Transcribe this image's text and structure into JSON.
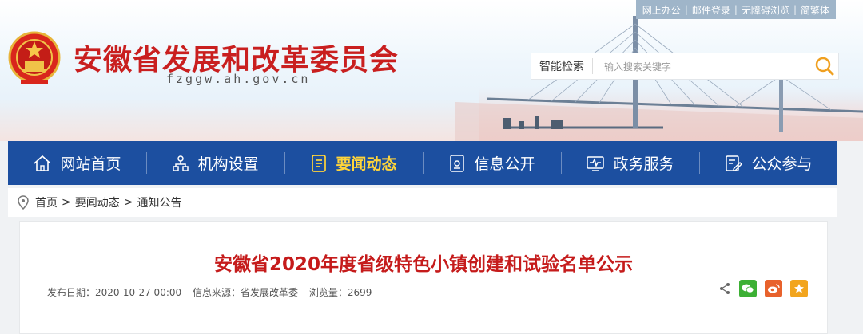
{
  "top_links": [
    "网上办公",
    "邮件登录",
    "无障碍浏览",
    "简繁体"
  ],
  "site": {
    "title": "安徽省发展和改革委员会",
    "domain": "fzggw.ah.gov.cn"
  },
  "search": {
    "label": "智能检索",
    "placeholder": "输入搜索关键字"
  },
  "nav": {
    "items": [
      {
        "label": "网站首页",
        "icon": "home-icon"
      },
      {
        "label": "机构设置",
        "icon": "org-chart-icon"
      },
      {
        "label": "要闻动态",
        "icon": "document-icon",
        "active": true
      },
      {
        "label": "信息公开",
        "icon": "info-board-icon"
      },
      {
        "label": "政务服务",
        "icon": "monitor-pulse-icon"
      },
      {
        "label": "公众参与",
        "icon": "edit-form-icon"
      }
    ],
    "active_color": "#ffd43a",
    "bg_color": "#1c4fa0"
  },
  "breadcrumb": [
    "首页",
    "要闻动态",
    "通知公告"
  ],
  "article": {
    "title": "安徽省2020年度省级特色小镇创建和试验名单公示",
    "publish_date": "发布日期：2020-10-27 00:00",
    "source": "信息来源：省发展改革委",
    "views": "浏览量：2699"
  },
  "share_icons": [
    "share-icon",
    "wechat-icon",
    "weibo-icon",
    "favorite-star-icon"
  ],
  "colors": {
    "title_red": "#c91f1f",
    "article_title_red": "#c51b1b"
  }
}
